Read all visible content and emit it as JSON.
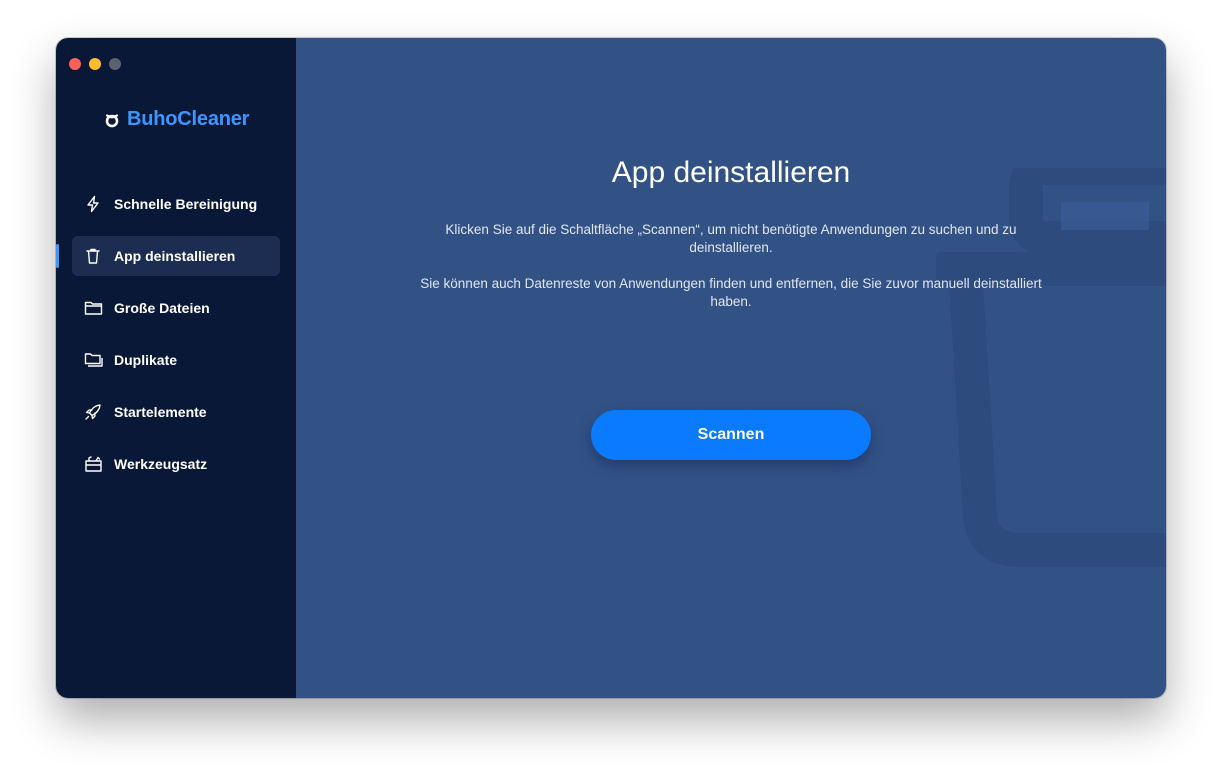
{
  "app": {
    "name": "BuhoCleaner",
    "brand_color": "#3d96ff",
    "sidebar_bg": "#0a1838",
    "main_bg": "#325286"
  },
  "window_controls": [
    "close",
    "minimize",
    "zoom"
  ],
  "sidebar": {
    "items": [
      {
        "label": "Schnelle Bereinigung",
        "icon": "lightning-icon",
        "active": false
      },
      {
        "label": "App deinstallieren",
        "icon": "trash-icon",
        "active": true
      },
      {
        "label": "Große Dateien",
        "icon": "folder-icon",
        "active": false
      },
      {
        "label": "Duplikate",
        "icon": "duplicate-folder-icon",
        "active": false
      },
      {
        "label": "Startelemente",
        "icon": "rocket-icon",
        "active": false
      },
      {
        "label": "Werkzeugsatz",
        "icon": "toolbox-icon",
        "active": false
      }
    ]
  },
  "main": {
    "title": "App deinstallieren",
    "description_1": "Klicken Sie auf die Schaltfläche „Scannen“, um nicht benötigte Anwendungen zu suchen und zu deinstallieren.",
    "description_2": "Sie können auch Datenreste von Anwendungen finden und entfernen, die Sie zuvor manuell deinstalliert haben.",
    "scan_button_label": "Scannen",
    "scan_button_color": "#0a7bff",
    "background_icon": "trash-icon"
  }
}
